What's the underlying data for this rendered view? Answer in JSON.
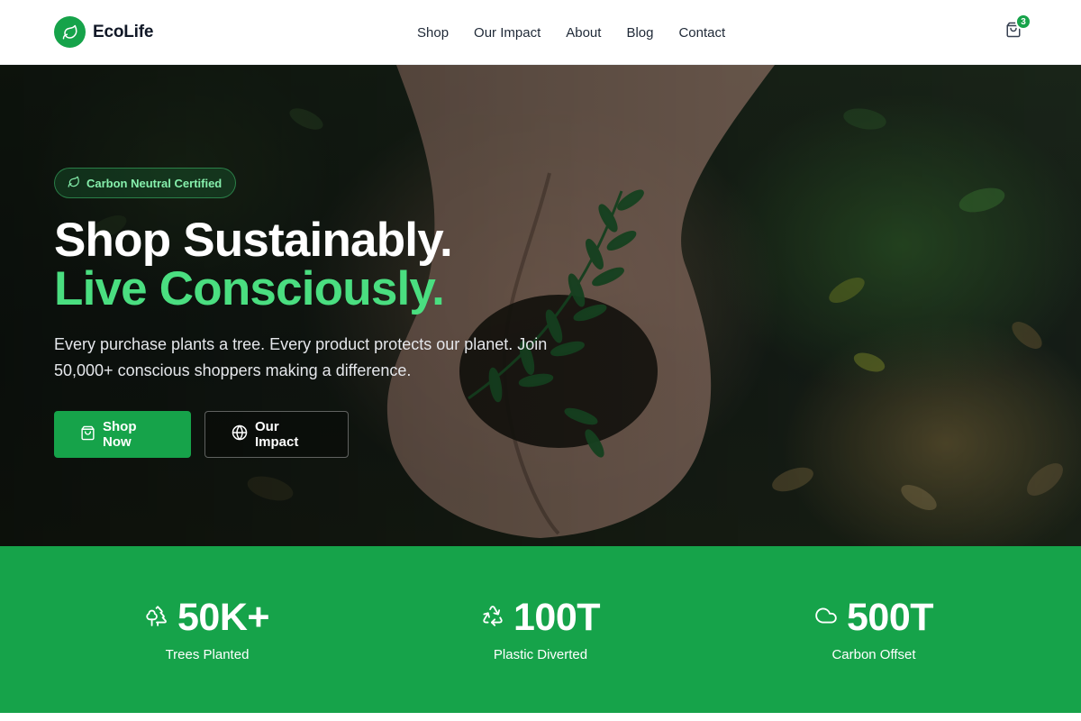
{
  "brand": {
    "name": "EcoLife",
    "logo_icon": "leaf-icon"
  },
  "nav": {
    "items": [
      {
        "label": "Shop"
      },
      {
        "label": "Our Impact"
      },
      {
        "label": "About"
      },
      {
        "label": "Blog"
      },
      {
        "label": "Contact"
      }
    ]
  },
  "cart": {
    "icon": "shopping-bag-icon",
    "count": "3"
  },
  "hero": {
    "badge": "Carbon Neutral Certified",
    "headline_line1": "Shop Sustainably.",
    "headline_line2": "Live Consciously.",
    "subtext": "Every purchase plants a tree. Every product protects our planet. Join 50,000+ conscious shoppers making a difference.",
    "primary_cta": "Shop Now",
    "secondary_cta": "Our Impact"
  },
  "stats": [
    {
      "value": "50K+",
      "label": "Trees Planted",
      "icon": "trees-icon"
    },
    {
      "value": "100T",
      "label": "Plastic Diverted",
      "icon": "recycle-icon"
    },
    {
      "value": "500T",
      "label": "Carbon Offset",
      "icon": "cloud-icon"
    }
  ],
  "colors": {
    "brand_green": "#16a34a",
    "accent_green": "#4ade80",
    "text_dark": "#111827"
  }
}
